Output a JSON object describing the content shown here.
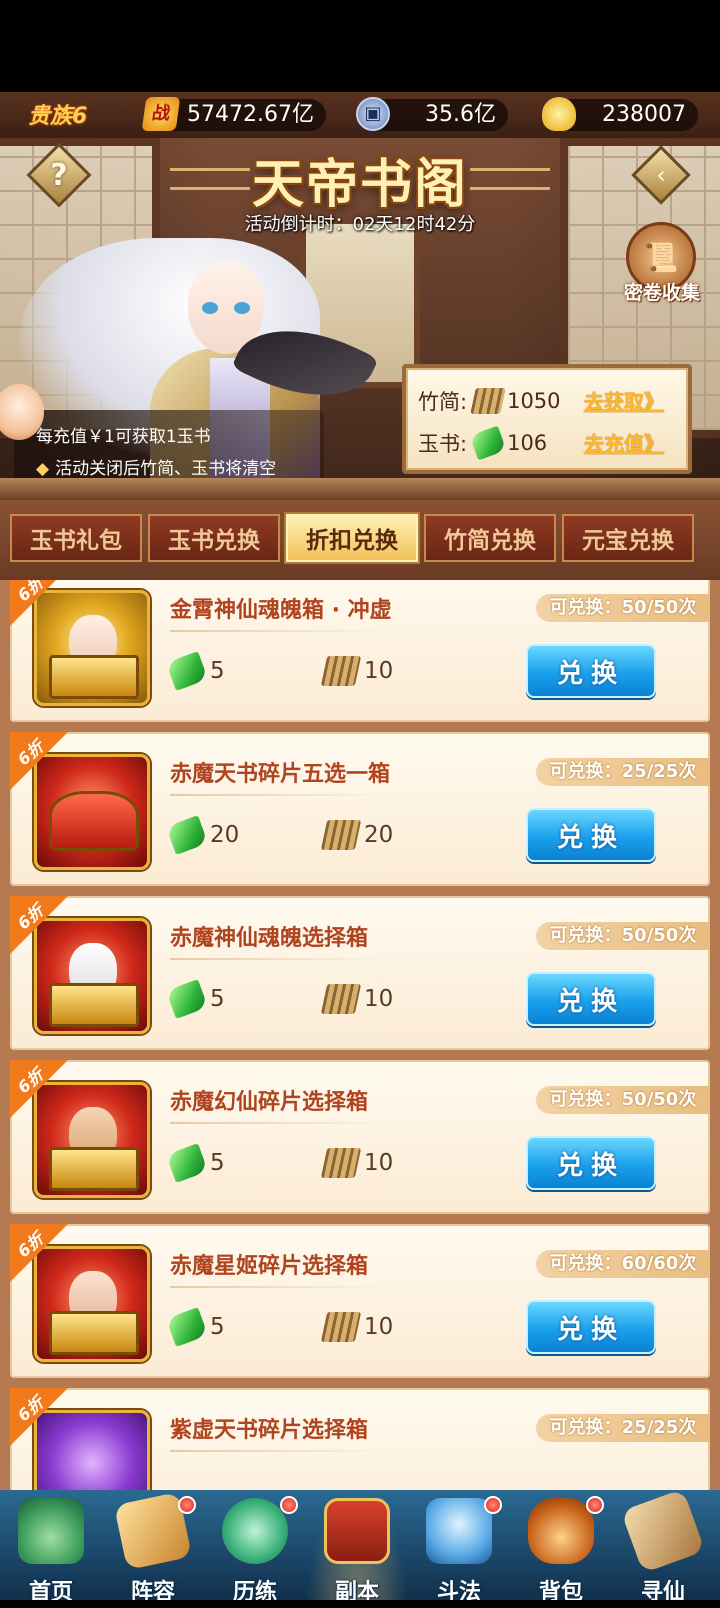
{
  "topbar": {
    "vip": "贵族6",
    "power_icon": "战",
    "power": "57472.67亿",
    "silver": "35.6亿",
    "gold": "238007"
  },
  "banner": {
    "title": "天帝书阁",
    "countdown": "活动倒计时：02天12时42分",
    "collect_label": "密卷收集",
    "info_1": "每充值￥1可获取1玉书",
    "info_2": "活动关闭后竹简、玉书将清空",
    "resources": [
      {
        "label": "竹简:",
        "value": "1050",
        "link": "去获取》"
      },
      {
        "label": "玉书:",
        "value": "106",
        "link": "去充值》"
      }
    ]
  },
  "tabs": [
    "玉书礼包",
    "玉书兑换",
    "折扣兑换",
    "竹简兑换",
    "元宝兑换"
  ],
  "active_tab": "折扣兑换",
  "items": [
    {
      "badge": "6折",
      "title": "金霄神仙魂魄箱 · 冲虚",
      "jade": "5",
      "bamboo": "10",
      "quota": "可兑换：50/50次",
      "button": "兑换"
    },
    {
      "badge": "6折",
      "title": "赤魔天书碎片五选一箱",
      "jade": "20",
      "bamboo": "20",
      "quota": "可兑换：25/25次",
      "button": "兑换"
    },
    {
      "badge": "6折",
      "title": "赤魔神仙魂魄选择箱",
      "jade": "5",
      "bamboo": "10",
      "quota": "可兑换：50/50次",
      "button": "兑换"
    },
    {
      "badge": "6折",
      "title": "赤魔幻仙碎片选择箱",
      "jade": "5",
      "bamboo": "10",
      "quota": "可兑换：50/50次",
      "button": "兑换"
    },
    {
      "badge": "6折",
      "title": "赤魔星姬碎片选择箱",
      "jade": "5",
      "bamboo": "10",
      "quota": "可兑换：60/60次",
      "button": "兑换"
    },
    {
      "badge": "6折",
      "title": "紫虚天书碎片选择箱",
      "quota": "可兑换：25/25次"
    }
  ],
  "nav": [
    {
      "label": "首页",
      "icon": "home-icon"
    },
    {
      "label": "阵容",
      "icon": "lineup-icon"
    },
    {
      "label": "历练",
      "icon": "training-icon"
    },
    {
      "label": "副本",
      "icon": "dungeon-icon"
    },
    {
      "label": "斗法",
      "icon": "battle-icon"
    },
    {
      "label": "背包",
      "icon": "bag-icon"
    },
    {
      "label": "寻仙",
      "icon": "seek-icon"
    }
  ],
  "colors": {
    "accent_orange": "#f07a1c",
    "button_blue": "#1aa0ec",
    "title_red": "#b0441e",
    "link_gold": "#ffb82a"
  }
}
